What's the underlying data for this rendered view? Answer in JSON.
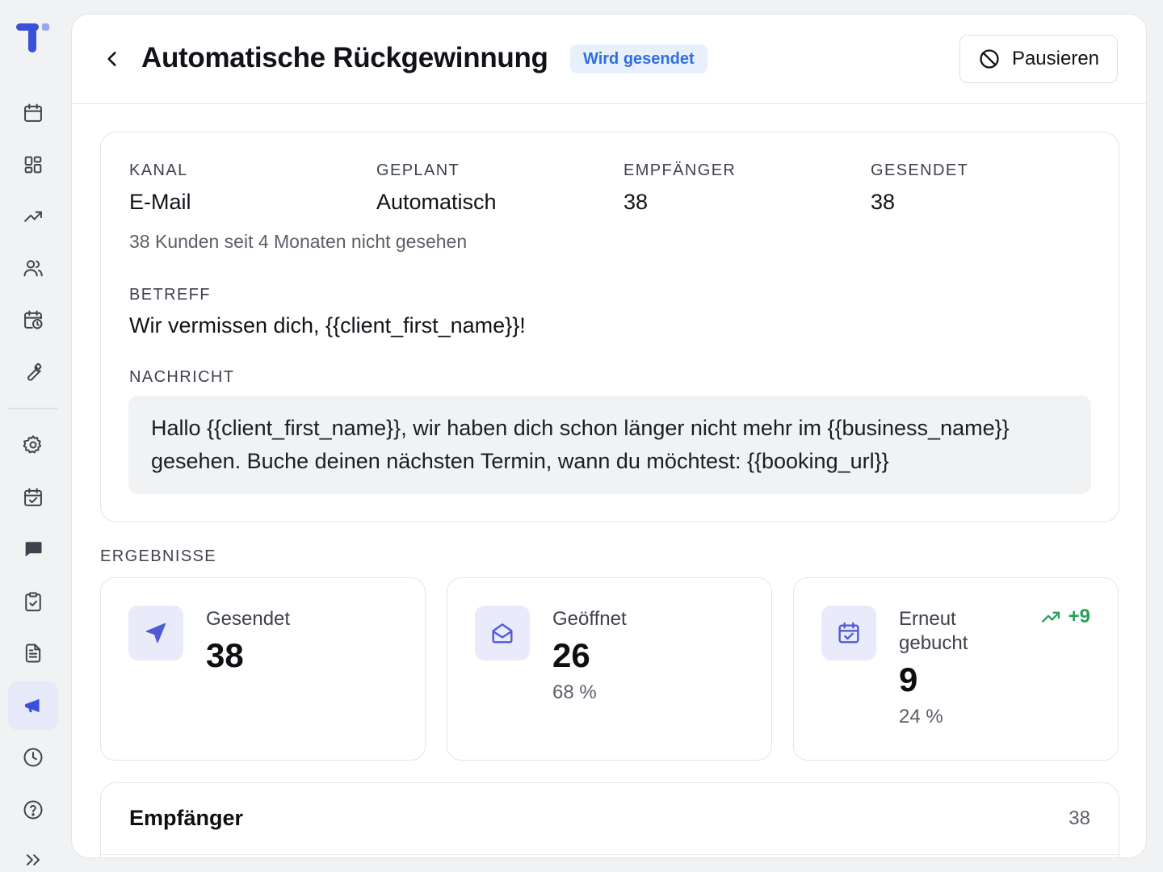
{
  "sidebar": {
    "items": [
      {
        "icon": "calendar-icon"
      },
      {
        "icon": "dashboard-icon"
      },
      {
        "icon": "trending-icon"
      },
      {
        "icon": "users-icon"
      },
      {
        "icon": "calendar-clock-icon"
      },
      {
        "icon": "wrench-icon"
      },
      {
        "icon": "settings-icon"
      },
      {
        "icon": "calendar-check-icon"
      },
      {
        "icon": "chat-icon"
      },
      {
        "icon": "clipboard-check-icon"
      },
      {
        "icon": "document-icon"
      },
      {
        "icon": "megaphone-icon",
        "active": true
      },
      {
        "icon": "clock-icon"
      },
      {
        "icon": "help-icon"
      },
      {
        "icon": "expand-icon"
      }
    ]
  },
  "header": {
    "title": "Automatische Rückgewinnung",
    "status": "Wird gesendet",
    "pause_label": "Pausieren"
  },
  "details": {
    "channel_label": "KANAL",
    "channel_value": "E-Mail",
    "planned_label": "GEPLANT",
    "planned_value": "Automatisch",
    "recipients_label": "EMPFÄNGER",
    "recipients_value": "38",
    "sent_label": "GESENDET",
    "sent_value": "38",
    "note": "38 Kunden seit 4 Monaten nicht gesehen",
    "subject_label": "BETREFF",
    "subject_value": "Wir vermissen dich, {{client_first_name}}!",
    "message_label": "NACHRICHT",
    "message_value": "Hallo {{client_first_name}}, wir haben dich schon länger nicht mehr im {{business_name}} gesehen. Buche deinen nächsten Termin, wann du möchtest: {{booking_url}}"
  },
  "results": {
    "label": "ERGEBNISSE",
    "cards": [
      {
        "label": "Gesendet",
        "value": "38",
        "percent": "",
        "icon": "send-icon"
      },
      {
        "label": "Geöffnet",
        "value": "26",
        "percent": "68 %",
        "icon": "mail-open-icon"
      },
      {
        "label": "Erneut gebucht",
        "value": "9",
        "percent": "24 %",
        "icon": "calendar-check-icon",
        "trend": "+9"
      }
    ]
  },
  "recipients": {
    "title": "Empfänger",
    "count": "38"
  },
  "colors": {
    "accent": "#4f5bd5",
    "badge_text": "#2f6ee0",
    "badge_bg": "#e8f0fc",
    "trend_green": "#27a05a"
  }
}
